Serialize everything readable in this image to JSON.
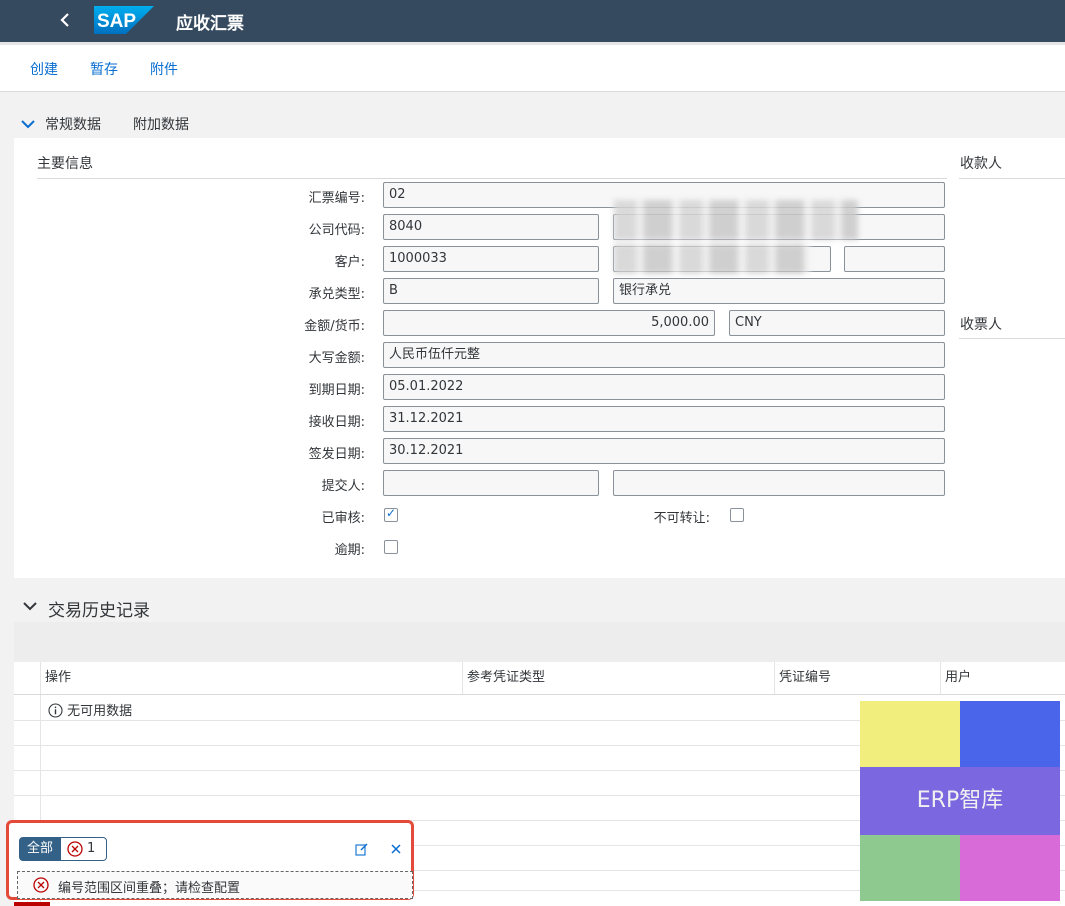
{
  "shell": {
    "back_icon": "chevron-left-icon",
    "logo": "SAP",
    "title": "应收汇票"
  },
  "toolbar": {
    "create": "创建",
    "draft": "暂存",
    "attachment": "附件"
  },
  "tabs": {
    "general": "常规数据",
    "additional": "附加数据"
  },
  "general": {
    "group_main": "主要信息",
    "group_payee": "收款人",
    "group_recipient": "收票人",
    "labels": {
      "bill_no": "汇票编号:",
      "company_code": "公司代码:",
      "customer": "客户:",
      "acceptance_type": "承兑类型:",
      "amount_currency": "金额/货币:",
      "amount_words": "大写金额:",
      "due_date": "到期日期:",
      "receipt_date": "接收日期:",
      "issue_date": "签发日期:",
      "submitter": "提交人:",
      "approved": "已审核:",
      "non_transferable": "不可转让:",
      "overdue": "逾期:"
    },
    "values": {
      "bill_no": "02",
      "company_code": "8040",
      "customer": "1000033",
      "acceptance_type": "B",
      "acceptance_type_text": "银行承兑",
      "amount": "5,000.00",
      "currency": "CNY",
      "amount_words": "人民币伍仟元整",
      "due_date": "05.01.2022",
      "receipt_date": "31.12.2021",
      "issue_date": "30.12.2021",
      "submitter": "",
      "submitter_name": "",
      "approved": true,
      "non_transferable": false,
      "overdue": false
    }
  },
  "history": {
    "title": "交易历史记录",
    "columns": [
      "操作",
      "参考凭证类型",
      "凭证编号",
      "用户"
    ],
    "no_data": "无可用数据"
  },
  "messages": {
    "filter_all": "全部",
    "error_count": "1",
    "items": [
      {
        "type": "error",
        "text": "编号范围区间重叠；请检查配置"
      }
    ]
  },
  "watermark": {
    "text": "ERP智库",
    "colors": [
      "#f2ee7e",
      "#4a65ea",
      "#7b68e0",
      "#8ec98f",
      "#d86bd8"
    ]
  }
}
